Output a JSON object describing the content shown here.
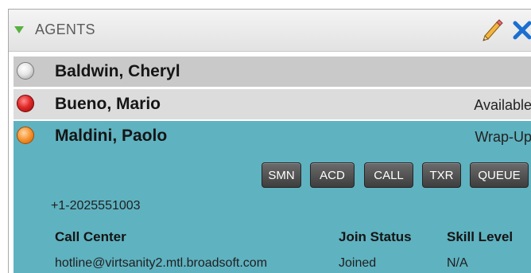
{
  "panel": {
    "title": "AGENTS",
    "icons": [
      "edit-pencil-icon",
      "close-x-icon"
    ]
  },
  "agents": [
    {
      "name": "Baldwin, Cheryl",
      "status": "",
      "status_color": "grey"
    },
    {
      "name": "Bueno, Mario",
      "status": "Available",
      "status_color": "red"
    },
    {
      "name": "Maldini, Paolo",
      "status": "Wrap-Up",
      "status_color": "orange"
    }
  ],
  "expanded_agent": {
    "buttons": [
      "SMN",
      "ACD",
      "CALL",
      "TXR",
      "QUEUE"
    ],
    "phone": "+1-2025551003",
    "table": {
      "headers": [
        "Call Center",
        "Join Status",
        "Skill Level"
      ],
      "rows": [
        [
          "hotline@virtsanity2.mtl.broadsoft.com",
          "Joined",
          "N/A"
        ]
      ]
    }
  },
  "colors": {
    "selected_row": "#5fb2c0",
    "row_grey": "#c9c9c9",
    "row_light": "#dcdcdc",
    "collapse_arrow": "#58b13f",
    "close_icon": "#1a6fd0"
  }
}
